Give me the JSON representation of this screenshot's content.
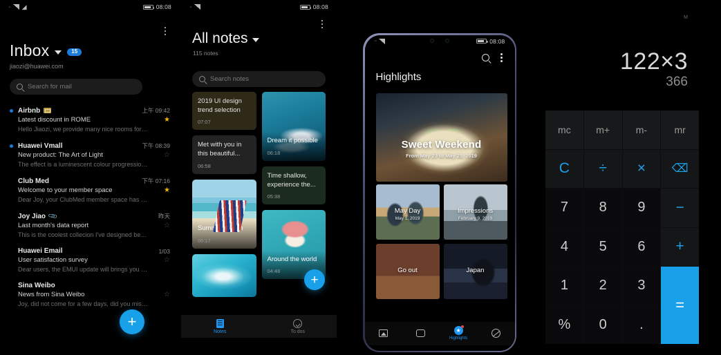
{
  "email": {
    "statusbar": {
      "time": "08:08"
    },
    "title": "Inbox",
    "badge": "15",
    "account": "jiaozi@huawei.com",
    "search_placeholder": "Search for mail",
    "items": [
      {
        "from": "Airbnb",
        "time": "上午 09:42",
        "subject": "Latest discount in ROME",
        "preview": "Hello Jiaozi, we provide many nice rooms for yo...",
        "unread": true,
        "starred": true,
        "tag": true,
        "attachment": false
      },
      {
        "from": "Huawei Vmall",
        "time": "下午 08:39",
        "subject": "New product: The Art of Light",
        "preview": "The effect is a luminescent colour progression ...",
        "unread": true,
        "starred": false,
        "tag": false,
        "attachment": false
      },
      {
        "from": "Club Med",
        "time": "下午 07:16",
        "subject": "Welcome to your member space",
        "preview": "Dear Joy, your ClubMed member space has bee...",
        "unread": false,
        "starred": true,
        "tag": false,
        "attachment": false
      },
      {
        "from": "Joy Jiao",
        "time": "昨天",
        "subject": "Last month's data report",
        "preview": "This is the coolest collecion I've designed befor...",
        "unread": false,
        "starred": false,
        "tag": false,
        "attachment": true
      },
      {
        "from": "Huawei Email",
        "time": "1/03",
        "subject": "User satisfaction survey",
        "preview": "Dear users, the EMUI update will brings you ma...",
        "unread": false,
        "starred": false,
        "tag": false,
        "attachment": false
      },
      {
        "from": "Sina Weibo",
        "time": "",
        "subject": "News from Sina Weibo",
        "preview": "Joy, did not come for a few days, did you miss t...",
        "unread": false,
        "starred": false,
        "tag": false,
        "attachment": false
      }
    ],
    "compose_label": "+"
  },
  "notes": {
    "statusbar": {
      "time": "08:08"
    },
    "title": "All notes",
    "count": "115 notes",
    "search_placeholder": "Search notes",
    "cards_left": [
      {
        "title": "2019 UI design trend selection",
        "time": "07:07",
        "kind": "text",
        "theme": "olive"
      },
      {
        "title": "Met with you in this beautiful...",
        "time": "06:58",
        "kind": "text",
        "theme": "grey"
      },
      {
        "title": "Summer Beach",
        "time": "05:17",
        "kind": "photo",
        "photo": "beach"
      },
      {
        "title": "",
        "time": "",
        "kind": "photo",
        "photo": "wave"
      }
    ],
    "cards_right": [
      {
        "title": "Dream it possible",
        "time": "06:18",
        "kind": "photo",
        "photo": "boat"
      },
      {
        "title": "Time shallow, experience the...",
        "time": "05:38",
        "kind": "text",
        "theme": "green"
      },
      {
        "title": "Around the world",
        "time": "04:48",
        "kind": "photo",
        "photo": "ice"
      }
    ],
    "new_note_label": "+",
    "tabs": [
      {
        "label": "Notes",
        "icon": "notes-icon",
        "active": true
      },
      {
        "label": "To dos",
        "icon": "check-circle-icon",
        "active": false
      }
    ]
  },
  "gallery": {
    "statusbar": {
      "time": "08:08"
    },
    "title": "Highlights",
    "hero": {
      "title": "Sweet Weekend",
      "subtitle": "From May 23 to May 25, 2019"
    },
    "cards": [
      {
        "title": "May Day",
        "subtitle": "May 1, 2019",
        "theme": "mayday"
      },
      {
        "title": "Impressions",
        "subtitle": "February 9, 2019",
        "theme": "impressions"
      },
      {
        "title": "Go out",
        "subtitle": "",
        "theme": "goout"
      },
      {
        "title": "Japan",
        "subtitle": "",
        "theme": "japan"
      }
    ],
    "tabs": [
      {
        "label": "",
        "icon": "photos-icon",
        "active": false
      },
      {
        "label": "",
        "icon": "albums-icon",
        "active": false
      },
      {
        "label": "Highlights",
        "icon": "highlights-icon",
        "active": true
      },
      {
        "label": "",
        "icon": "discover-icon",
        "active": false
      }
    ]
  },
  "calculator": {
    "memory_indicator": "M",
    "expression": "122×3",
    "result": "366",
    "keys": [
      {
        "label": "mc",
        "type": "mem"
      },
      {
        "label": "m+",
        "type": "mem"
      },
      {
        "label": "m-",
        "type": "mem"
      },
      {
        "label": "mr",
        "type": "mem"
      },
      {
        "label": "C",
        "type": "op"
      },
      {
        "label": "÷",
        "type": "op"
      },
      {
        "label": "×",
        "type": "op"
      },
      {
        "label": "⌫",
        "type": "op small"
      },
      {
        "label": "7",
        "type": "num"
      },
      {
        "label": "8",
        "type": "num"
      },
      {
        "label": "9",
        "type": "num"
      },
      {
        "label": "−",
        "type": "op"
      },
      {
        "label": "4",
        "type": "num"
      },
      {
        "label": "5",
        "type": "num"
      },
      {
        "label": "6",
        "type": "num"
      },
      {
        "label": "+",
        "type": "op"
      },
      {
        "label": "1",
        "type": "num"
      },
      {
        "label": "2",
        "type": "num"
      },
      {
        "label": "3",
        "type": "num"
      },
      {
        "label": "=",
        "type": "eq"
      },
      {
        "label": "%",
        "type": "num"
      },
      {
        "label": "0",
        "type": "num"
      },
      {
        "label": ".",
        "type": "num"
      }
    ]
  },
  "colors": {
    "accent_blue": "#18a0e8",
    "badge_blue": "#1a7bd9",
    "star_gold": "#f2b705",
    "background": "#000000"
  }
}
